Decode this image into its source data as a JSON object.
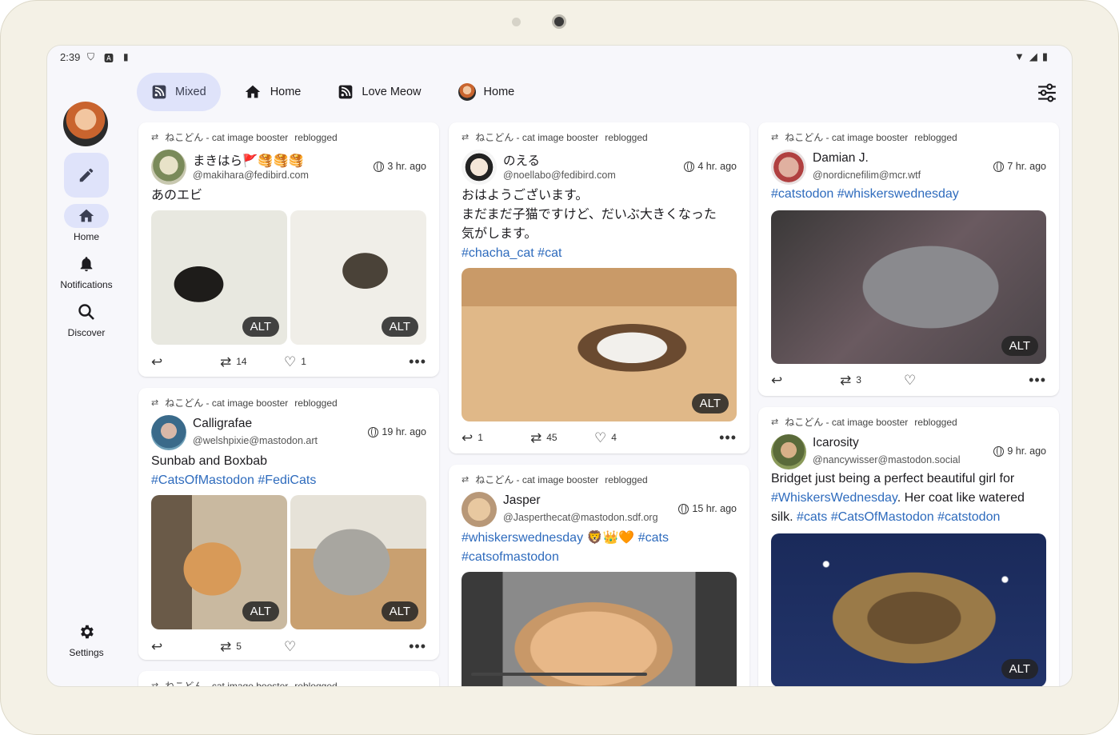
{
  "status": {
    "time": "2:39"
  },
  "sidebar": {
    "home_label": "Home",
    "notifications_label": "Notifications",
    "discover_label": "Discover",
    "settings_label": "Settings"
  },
  "tabs": [
    {
      "label": "Mixed",
      "icon": "rss-icon",
      "active": true
    },
    {
      "label": "Home",
      "icon": "home-icon",
      "active": false
    },
    {
      "label": "Love Meow",
      "icon": "rss-icon",
      "active": false
    },
    {
      "label": "Home",
      "icon": "avatar",
      "active": false
    }
  ],
  "boost_text": "ねこどん - cat image booster",
  "reblogged": "reblogged",
  "alt": "ALT",
  "posts": {
    "p1": {
      "name": "まきはら🚩🥞🥞🥞",
      "handle": "@makihara@fedibird.com",
      "time": "3 hr. ago",
      "text": "あのエビ",
      "boosts": "14",
      "favs": "1"
    },
    "p2": {
      "name": "Calligrafae",
      "handle": "@welshpixie@mastodon.art",
      "time": "19 hr. ago",
      "text": "Sunbab and Boxbab",
      "tags": "#CatsOfMastodon #FediCats",
      "boosts": "5"
    },
    "p3": {
      "name": "のえる",
      "handle": "@noellabo@fedibird.com",
      "time": "4 hr. ago",
      "line1": "おはようございます。",
      "line2": "まだまだ子猫ですけど、だいぶ大きくなった",
      "line3": "気がします。",
      "tags": "#chacha_cat #cat",
      "replies": "1",
      "boosts": "45",
      "favs": "4"
    },
    "p4": {
      "name": "Jasper",
      "handle": "@Jasperthecat@mastodon.sdf.org",
      "time": "15 hr. ago",
      "tags1": "#whiskerswednesday",
      "emoji": "🦁👑🧡",
      "tags1b": "#cats",
      "tags2": "#catsofmastodon"
    },
    "p5": {
      "name": "Damian J.",
      "handle": "@nordicnefilim@mcr.wtf",
      "time": "7 hr. ago",
      "tags": "#catstodon #whiskerswednesday",
      "boosts": "3"
    },
    "p6": {
      "name": "Icarosity",
      "handle": "@nancywisser@mastodon.social",
      "time": "9 hr. ago",
      "t1": "Bridget just being a perfect beautiful girl for",
      "t2a": "#WhiskersWednesday",
      "t2b": ". Her coat like watered",
      "t3a": "silk. ",
      "t3b": "#cats #CatsOfMastodon #catstodon"
    }
  },
  "colors": {
    "accent": "#dfe3fa",
    "link": "#2e6bbd",
    "background": "#f7f7fb"
  }
}
